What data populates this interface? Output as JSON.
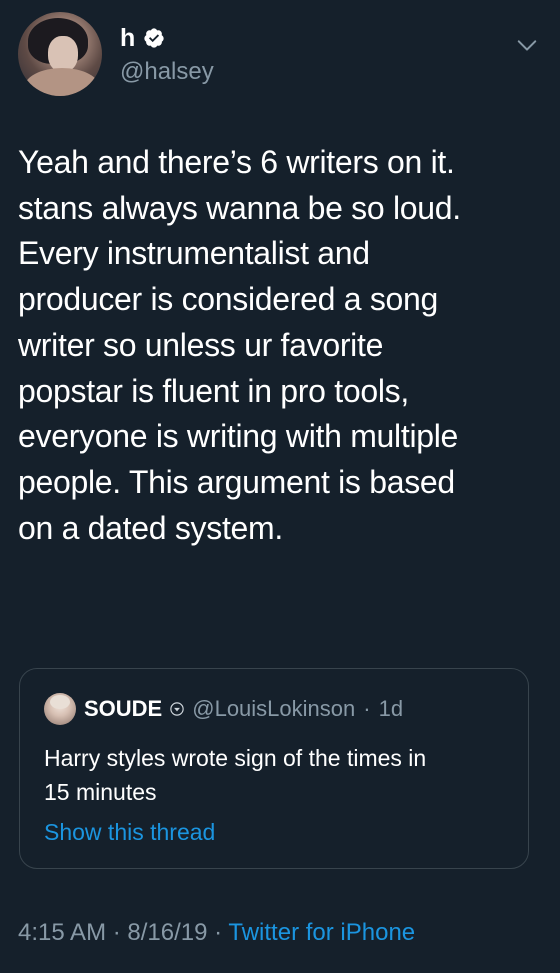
{
  "tweet": {
    "author": {
      "display_name": "h",
      "handle": "@halsey",
      "verified": true,
      "avatar_icon": "avatar-photo"
    },
    "menu_icon": "chevron-down-icon",
    "text": "Yeah and there’s 6 writers on it.\nstans always wanna be so loud.\nEvery instrumentalist and\nproducer is considered a song\nwriter so unless ur favorite\npopstar is fluent in pro tools,\neveryone is writing with multiple\npeople. This argument is based\non a dated system.",
    "quoted": {
      "name": "SOUDE",
      "badge_icon": "badge-icon",
      "handle": "@LouisLokinson",
      "separator": "·",
      "time": "1d",
      "text": "Harry styles wrote sign of the times in\n15 minutes",
      "show_thread": "Show this thread"
    },
    "footer": {
      "time": "4:15 AM",
      "sep1": "·",
      "date": "8/16/19",
      "sep2": "·",
      "source": "Twitter for iPhone"
    }
  },
  "colors": {
    "background": "#15202b",
    "text": "#ffffff",
    "muted": "#8899a6",
    "link": "#1b95e0",
    "border": "#38444d"
  }
}
